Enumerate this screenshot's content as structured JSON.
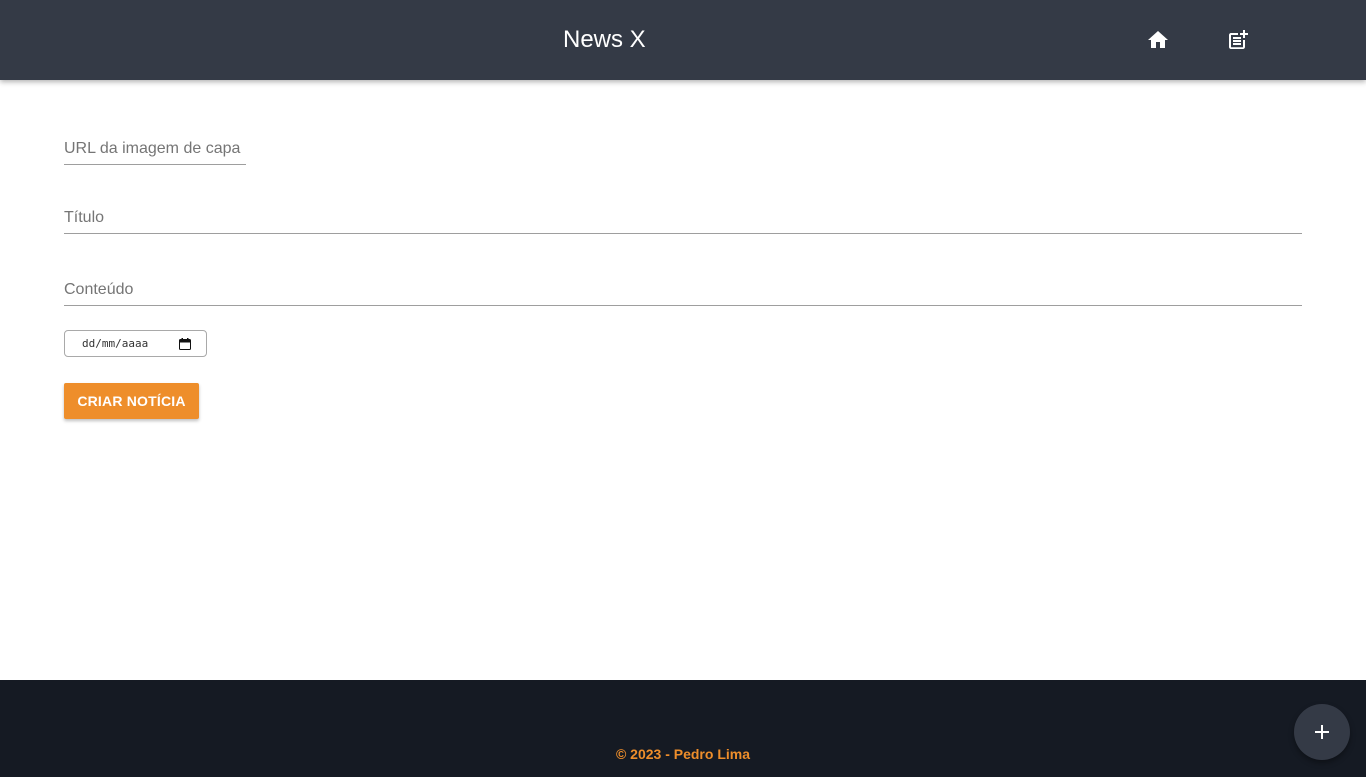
{
  "navbar": {
    "brand": "News X",
    "icons": [
      "home-icon",
      "post-add-icon"
    ],
    "background": "#343a46"
  },
  "form": {
    "cover_url_label": "URL da imagem de capa",
    "title_label": "Título",
    "content_label": "Conteúdo",
    "date_placeholder": "dd/mm/aaaa",
    "submit_label": "CRIAR NOTÍCIA",
    "accent": "#ee8e2b"
  },
  "footer": {
    "text": "© 2023 - Pedro Lima",
    "background": "#151a23"
  },
  "fab": {
    "icon": "plus-icon"
  }
}
